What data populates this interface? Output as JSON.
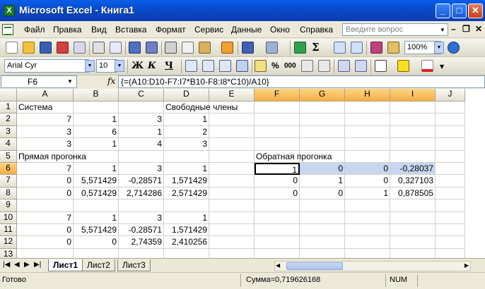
{
  "window": {
    "title": "Microsoft Excel - Книга1"
  },
  "menu": {
    "items": [
      {
        "label": "Файл"
      },
      {
        "label": "Правка"
      },
      {
        "label": "Вид"
      },
      {
        "label": "Вставка"
      },
      {
        "label": "Формат"
      },
      {
        "label": "Сервис"
      },
      {
        "label": "Данные"
      },
      {
        "label": "Окно"
      },
      {
        "label": "Справка"
      }
    ],
    "help_placeholder": "Введите вопрос"
  },
  "toolbar": {
    "zoom": "100%"
  },
  "format_toolbar": {
    "font": "Arial Cyr",
    "size": "10",
    "bold": "Ж",
    "italic": "К",
    "underline": "Ч"
  },
  "formula_bar": {
    "name_box": "F6",
    "fx": "fx",
    "formula": "{=(A10:D10-F7:I7*B10-F8:I8*C10)/A10}"
  },
  "grid": {
    "columns": [
      "A",
      "B",
      "C",
      "D",
      "E",
      "F",
      "G",
      "H",
      "I",
      "J"
    ],
    "rows": [
      "1",
      "2",
      "3",
      "4",
      "5",
      "6",
      "7",
      "8",
      "9",
      "10",
      "11",
      "12",
      "13"
    ],
    "cells": {
      "A1": "Система",
      "D1": "Свободные члены",
      "A2": "7",
      "B2": "1",
      "C2": "3",
      "D2": "1",
      "A3": "3",
      "B3": "6",
      "C3": "1",
      "D3": "2",
      "A4": "3",
      "B4": "1",
      "C4": "4",
      "D4": "3",
      "A5": "Прямая прогонка",
      "F5": "Обратная прогонка",
      "A6": "7",
      "B6": "1",
      "C6": "3",
      "D6": "1",
      "F6": "1",
      "G6": "0",
      "H6": "0",
      "I6": "-0,28037",
      "A7": "0",
      "B7": "5,571429",
      "C7": "-0,28571",
      "D7": "1,571429",
      "F7": "0",
      "G7": "1",
      "H7": "0",
      "I7": "0,327103",
      "A8": "0",
      "B8": "0,571429",
      "C8": "2,714286",
      "D8": "2,571429",
      "F8": "0",
      "G8": "0",
      "H8": "1",
      "I8": "0,878505",
      "A10": "7",
      "B10": "1",
      "C10": "3",
      "D10": "1",
      "A11": "0",
      "B11": "5,571429",
      "C11": "-0,28571",
      "D11": "1,571429",
      "A12": "0",
      "B12": "0",
      "C12": "2,74359",
      "D12": "2,410256"
    }
  },
  "sheets": {
    "tabs": [
      "Лист1",
      "Лист2",
      "Лист3"
    ],
    "active": "Лист1"
  },
  "status": {
    "ready": "Готово",
    "sum": "Сумма=0,719626168",
    "num": "NUM"
  },
  "colors": {
    "title_bar": "#0a5ee8",
    "selection_highlight": "#c7d7f2",
    "header_selected": "#f7ae45"
  }
}
